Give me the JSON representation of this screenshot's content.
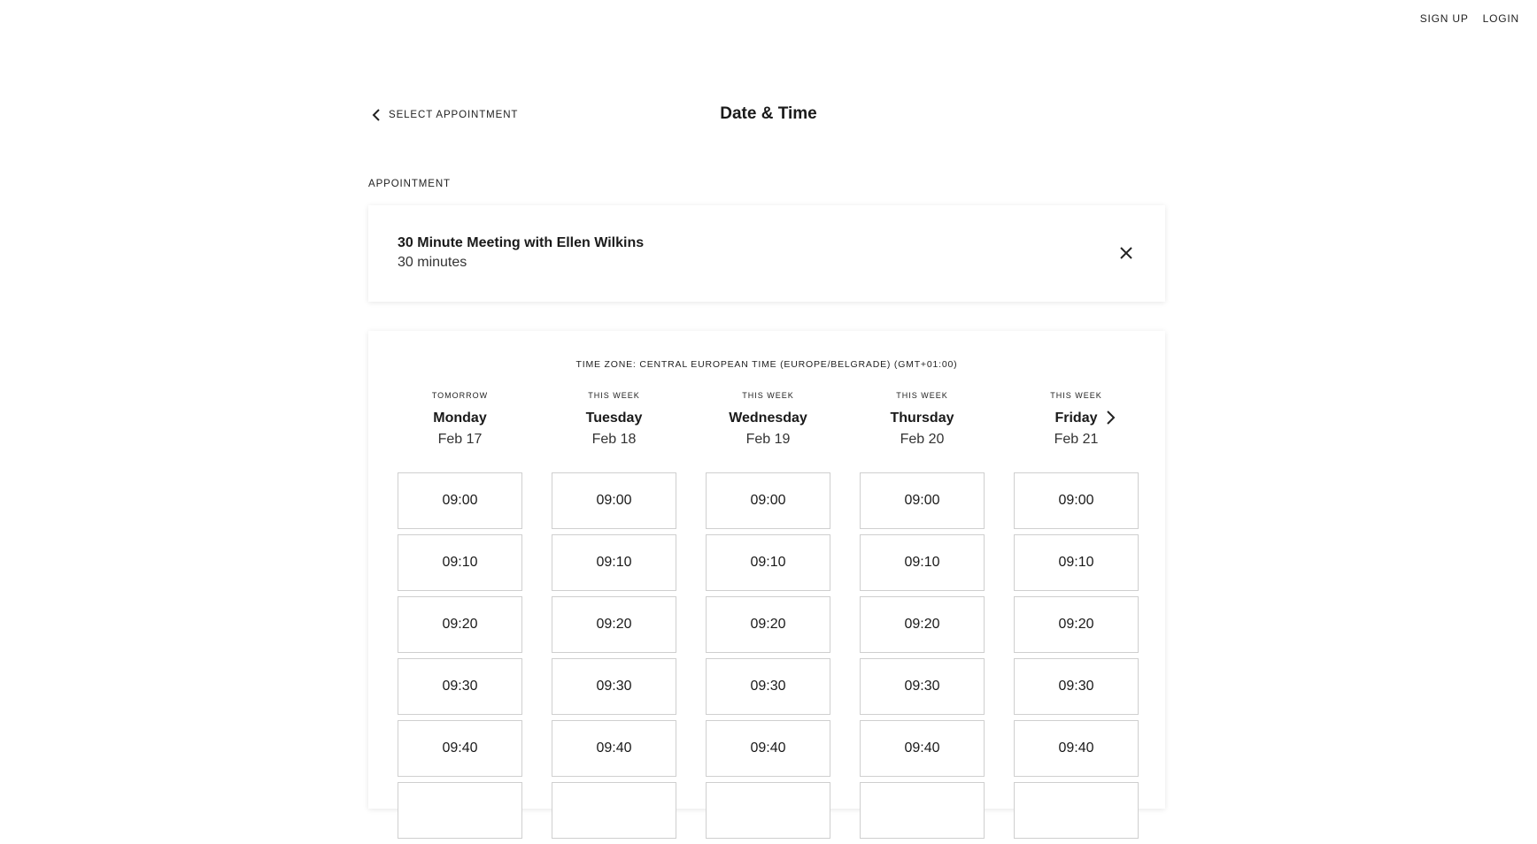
{
  "topnav": {
    "signup": "SIGN UP",
    "login": "LOGIN"
  },
  "header": {
    "back_label": "SELECT APPOINTMENT",
    "title": "Date & Time"
  },
  "appointment": {
    "section_label": "APPOINTMENT",
    "title": "30 Minute Meeting with Ellen Wilkins",
    "duration": "30 minutes"
  },
  "calendar": {
    "timezone": "TIME ZONE: CENTRAL EUROPEAN TIME (EUROPE/BELGRADE) (GMT+01:00)",
    "days": [
      {
        "kicker": "TOMORROW",
        "name": "Monday",
        "date": "Feb 17"
      },
      {
        "kicker": "THIS WEEK",
        "name": "Tuesday",
        "date": "Feb 18"
      },
      {
        "kicker": "THIS WEEK",
        "name": "Wednesday",
        "date": "Feb 19"
      },
      {
        "kicker": "THIS WEEK",
        "name": "Thursday",
        "date": "Feb 20"
      },
      {
        "kicker": "THIS WEEK",
        "name": "Friday",
        "date": "Feb 21"
      }
    ],
    "slots": [
      "09:00",
      "09:10",
      "09:20",
      "09:30",
      "09:40",
      ""
    ]
  }
}
